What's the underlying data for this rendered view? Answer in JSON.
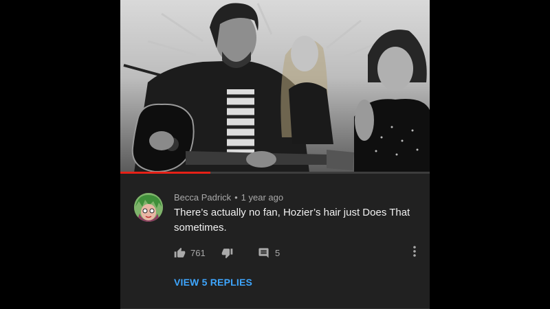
{
  "video": {
    "progress_fraction": 0.29
  },
  "comment": {
    "author": "Becca Padrick",
    "separator": "•",
    "time_ago": "1 year ago",
    "text": "There’s actually no fan, Hozier’s hair just Does That sometimes.",
    "like_count": "761",
    "reply_count": "5",
    "view_replies_label": "VIEW 5 REPLIES"
  },
  "icons": {
    "like": "thumbs-up-icon",
    "dislike": "thumbs-down-icon",
    "reply": "comment-icon",
    "more": "more-vertical-icon"
  },
  "colors": {
    "background": "#212121",
    "progress": "#e62117",
    "link": "#3ea6ff",
    "meta_text": "#aaaaaa",
    "body_text": "#f1f1f1"
  }
}
